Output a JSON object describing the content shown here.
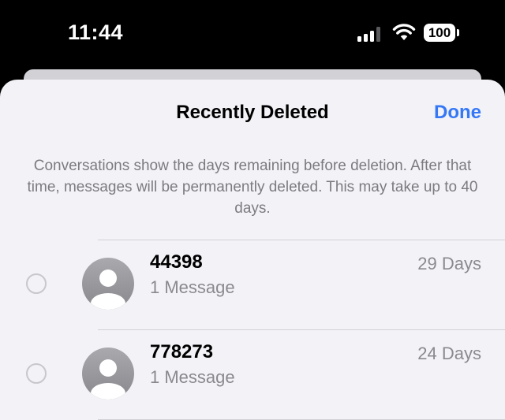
{
  "status_bar": {
    "time": "11:44",
    "battery_level": "100",
    "signal_bars_active": 3,
    "signal_bars_total": 4
  },
  "sheet": {
    "title": "Recently Deleted",
    "done_label": "Done",
    "description": "Conversations show the days remaining before deletion. After that time, messages will be permanently deleted. This may take up to 40 days."
  },
  "conversations": [
    {
      "name": "44398",
      "subtitle": "1 Message",
      "days": "29 Days"
    },
    {
      "name": "778273",
      "subtitle": "1 Message",
      "days": "24 Days"
    }
  ],
  "colors": {
    "accent": "#3478f6",
    "sheet_background": "#f2f2f7",
    "secondary_text": "#8a8a8e",
    "avatar_gradient_top": "#a9a9ae",
    "avatar_gradient_bottom": "#88888d"
  },
  "icons": {
    "signal": "cellular-signal-icon",
    "wifi": "wifi-icon",
    "battery": "battery-icon",
    "avatar": "person-avatar-icon",
    "selection": "empty-circle-icon"
  }
}
